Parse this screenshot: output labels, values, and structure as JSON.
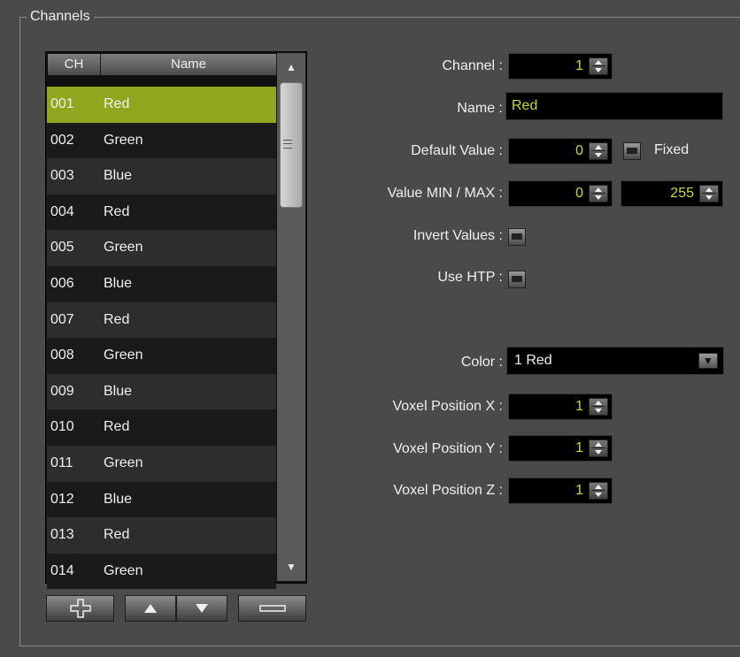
{
  "group": {
    "title": "Channels"
  },
  "table": {
    "columns": [
      "CH",
      "Name"
    ],
    "rows": [
      {
        "ch": "001",
        "name": "Red"
      },
      {
        "ch": "002",
        "name": "Green"
      },
      {
        "ch": "003",
        "name": "Blue"
      },
      {
        "ch": "004",
        "name": "Red"
      },
      {
        "ch": "005",
        "name": "Green"
      },
      {
        "ch": "006",
        "name": "Blue"
      },
      {
        "ch": "007",
        "name": "Red"
      },
      {
        "ch": "008",
        "name": "Green"
      },
      {
        "ch": "009",
        "name": "Blue"
      },
      {
        "ch": "010",
        "name": "Red"
      },
      {
        "ch": "011",
        "name": "Green"
      },
      {
        "ch": "012",
        "name": "Blue"
      },
      {
        "ch": "013",
        "name": "Red"
      },
      {
        "ch": "014",
        "name": "Green"
      }
    ],
    "selected_index": 0
  },
  "buttons": {
    "add_icon": "plus-icon",
    "up_icon": "arrow-up-icon",
    "down_icon": "arrow-down-icon",
    "remove_icon": "minus-icon"
  },
  "form": {
    "channel_label": "Channel :",
    "channel_value": "1",
    "name_label": "Name :",
    "name_value": "Red",
    "default_label": "Default Value :",
    "default_value": "0",
    "fixed_label": "Fixed",
    "minmax_label": "Value MIN / MAX :",
    "min_value": "0",
    "max_value": "255",
    "invert_label": "Invert Values :",
    "htp_label": "Use HTP :",
    "color_label": "Color :",
    "color_value": "1  Red",
    "voxel_x_label": "Voxel Position X :",
    "voxel_x_value": "1",
    "voxel_y_label": "Voxel Position Y :",
    "voxel_y_value": "1",
    "voxel_z_label": "Voxel Position Z :",
    "voxel_z_value": "1"
  },
  "colors": {
    "accent": "#8fa71e",
    "value_text": "#c4dc2f",
    "background": "#4a4a4a"
  }
}
